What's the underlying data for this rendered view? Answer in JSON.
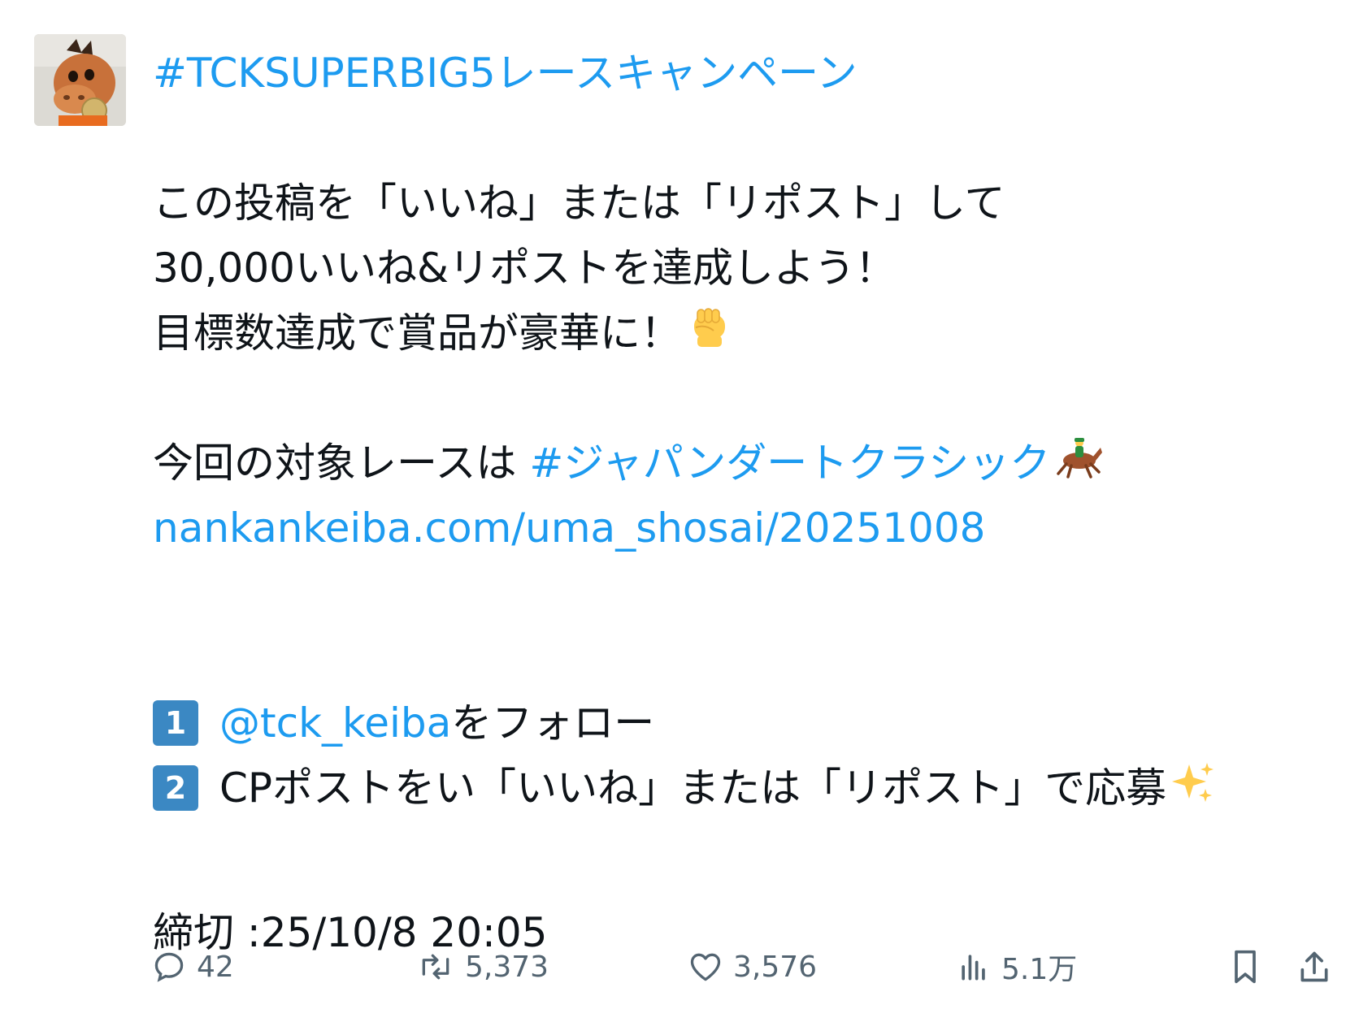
{
  "tweet": {
    "hashtag_title": "#TCKSUPERBIG5レースキャンペーン",
    "line1": "この投稿を「いいね」または「リポスト」して",
    "line2": "30,000いいね&リポストを達成しよう！",
    "line3": "目標数達成で賞品が豪華に！",
    "line4_prefix": "今回の対象レースは ",
    "line4_hashtag": "#ジャパンダートクラシック",
    "url": "nankankeiba.com/uma_shosai/20251008",
    "step1_num": "1",
    "step1_mention": "@tck_keiba",
    "step1_suffix": "をフォロー",
    "step2_num": "2",
    "step2_text": "CPポストをい「いいね」または「リポスト」で応募",
    "deadline": "締切 :25/10/8 20:05"
  },
  "emoji": {
    "fist": "raised-fist-icon",
    "horse": "horse-racing-icon",
    "sparkles": "sparkles-icon"
  },
  "actions": {
    "replies": "42",
    "reposts": "5,373",
    "likes": "3,576",
    "views": "5.1万"
  },
  "colors": {
    "link": "#1d9bf0",
    "text": "#0f1419",
    "muted": "#536471",
    "keycap": "#3b88c3"
  }
}
